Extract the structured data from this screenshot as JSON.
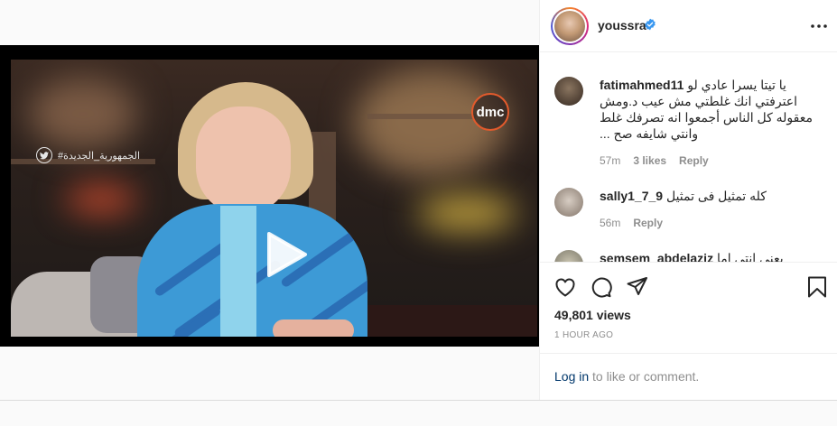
{
  "post": {
    "username": "youssra",
    "verified_icon": "verified-badge-icon",
    "more_icon": "more-options-icon"
  },
  "video": {
    "channel_logo": "dmc",
    "channel_tag": "#الجمهورية_الجديدة",
    "play_icon": "play-icon"
  },
  "comments": [
    {
      "user": "fatimahmed11",
      "text": "يا تيتا يسرا عادي لو اعترفتي انك غلطتي مش عيب د.ومش معقوله كل الناس أجمعوا انه تصرفك غلط وانتي شايفه صح ...",
      "time": "57m",
      "likes": "3 likes",
      "reply": "Reply"
    },
    {
      "user": "sally1_7_9",
      "text": "كله تمثيل فى تمثيل",
      "time": "56m",
      "reply": "Reply"
    },
    {
      "user": "semsem_abdelaziz",
      "text": "يعني انتي اما"
    }
  ],
  "actions": {
    "views": "49,801 views",
    "time_ago": "1 HOUR AGO",
    "login_link": "Log in",
    "login_suffix": " to like or comment."
  },
  "colors": {
    "link": "#00376b",
    "muted": "#8e8e8e",
    "text": "#262626",
    "verified": "#3897f0"
  }
}
